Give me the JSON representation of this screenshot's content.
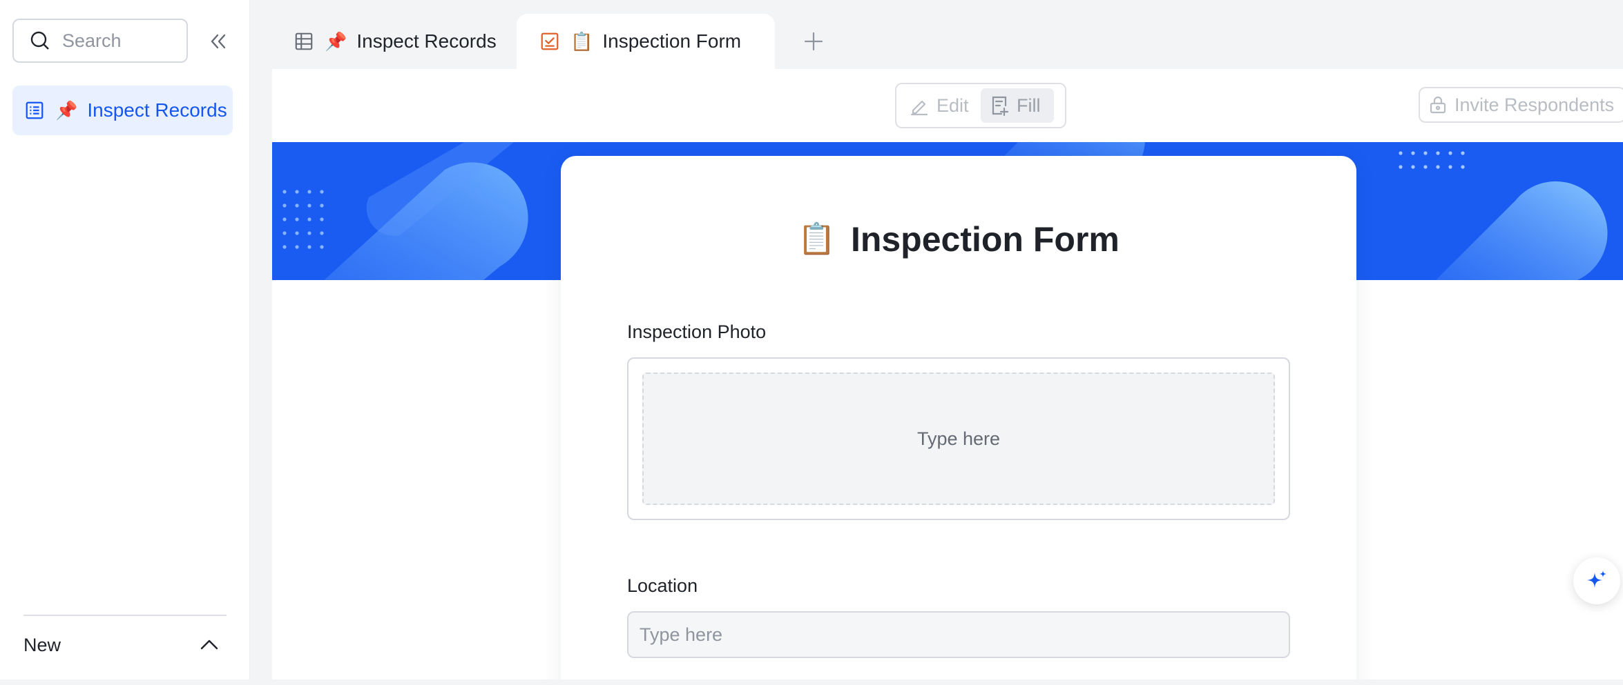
{
  "sidebar": {
    "search_placeholder": "Search",
    "items": [
      {
        "label": "Inspect Records",
        "icon": "table-list-icon",
        "emoji": "📌"
      }
    ],
    "new_label": "New"
  },
  "tabs": [
    {
      "label": "Inspect Records",
      "icon": "grid-table-icon",
      "emoji": "📌",
      "active": false
    },
    {
      "label": "Inspection Form",
      "icon": "form-check-icon",
      "emoji": "📋",
      "active": true
    }
  ],
  "toolbar": {
    "edit_label": "Edit",
    "fill_label": "Fill",
    "invite_label": "Invite Respondents"
  },
  "form": {
    "title": "Inspection Form",
    "title_emoji": "📋",
    "fields": [
      {
        "label": "Inspection Photo",
        "placeholder": "Type here"
      },
      {
        "label": "Location",
        "placeholder": "Type here"
      }
    ]
  },
  "colors": {
    "accent": "#1456f0",
    "banner": "#1a5cf2",
    "tab_icon_orange": "#e0602a"
  }
}
